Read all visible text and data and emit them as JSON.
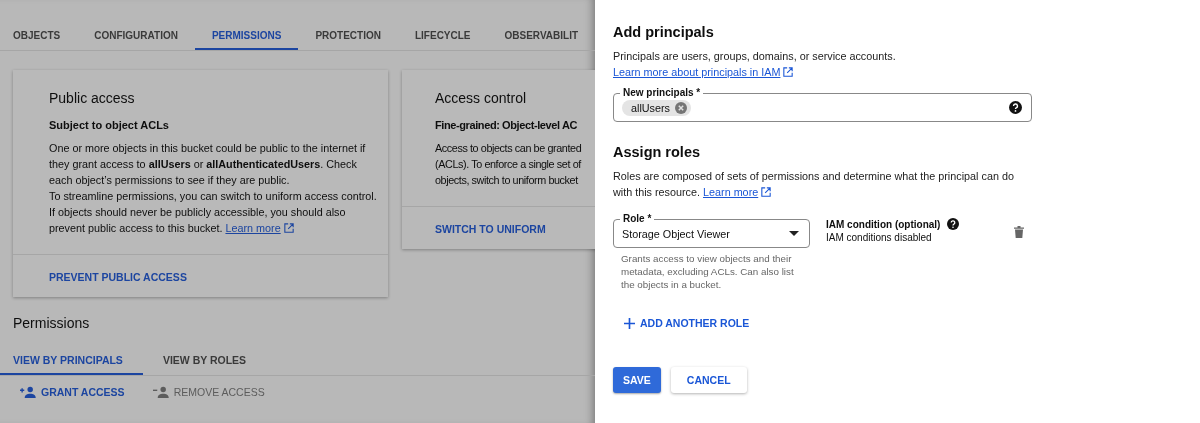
{
  "tabs": [
    {
      "label": "OBJECTS",
      "selected": false
    },
    {
      "label": "CONFIGURATION",
      "selected": false
    },
    {
      "label": "PERMISSIONS",
      "selected": true
    },
    {
      "label": "PROTECTION",
      "selected": false
    },
    {
      "label": "LIFECYCLE",
      "selected": false
    },
    {
      "label": "OBSERVABILIT",
      "selected": false
    }
  ],
  "public_access_card": {
    "title": "Public access",
    "subtitle": "Subject to object ACLs",
    "paragraphs": [
      "One or more objects in this bucket could be public to the internet if they grant access to **allUsers** or **allAuthenticatedUsers**. Check each object’s permissions to see if they are public.",
      "To streamline permissions, you can switch to uniform access control. If objects should never be publicly accessible, you should also prevent public access to this bucket."
    ],
    "link": "Learn more",
    "action": "PREVENT PUBLIC ACCESS"
  },
  "access_control_card": {
    "title": "Access control",
    "subtitle": "Fine-grained: Object-level AC",
    "lines": [
      "Access to objects can be granted",
      "(ACLs). To enforce a single set of",
      "objects, switch to uniform bucket"
    ],
    "action": "SWITCH TO UNIFORM"
  },
  "permissions": {
    "title": "Permissions",
    "view_tabs": [
      {
        "label": "VIEW BY PRINCIPALS",
        "selected": true
      },
      {
        "label": "VIEW BY ROLES",
        "selected": false
      }
    ],
    "actions": [
      {
        "label": "GRANT ACCESS",
        "kind": "add",
        "disabled": false
      },
      {
        "label": "REMOVE ACCESS",
        "kind": "remove",
        "disabled": true
      }
    ]
  },
  "panel": {
    "title": "Add principals",
    "description": "Principals are users, groups, domains, or service accounts.",
    "link": "Learn more about principals in IAM",
    "principals_field": {
      "label": "New principals *",
      "chips": [
        "allUsers"
      ]
    },
    "assign_roles": {
      "title": "Assign roles",
      "description": "Roles are composed of sets of permissions and determine what the principal can do with this resource.",
      "link": "Learn more"
    },
    "role": {
      "label": "Role *",
      "value": "Storage Object Viewer",
      "hint": "Grants access to view objects and their metadata, excluding ACLs. Can also list the objects in a bucket."
    },
    "iam_condition": {
      "title": "IAM condition (optional)",
      "value": "IAM conditions disabled"
    },
    "add_role": "ADD ANOTHER ROLE",
    "buttons": [
      {
        "label": "SAVE",
        "kind": "primary"
      },
      {
        "label": "CANCEL",
        "kind": "secondary"
      }
    ]
  }
}
